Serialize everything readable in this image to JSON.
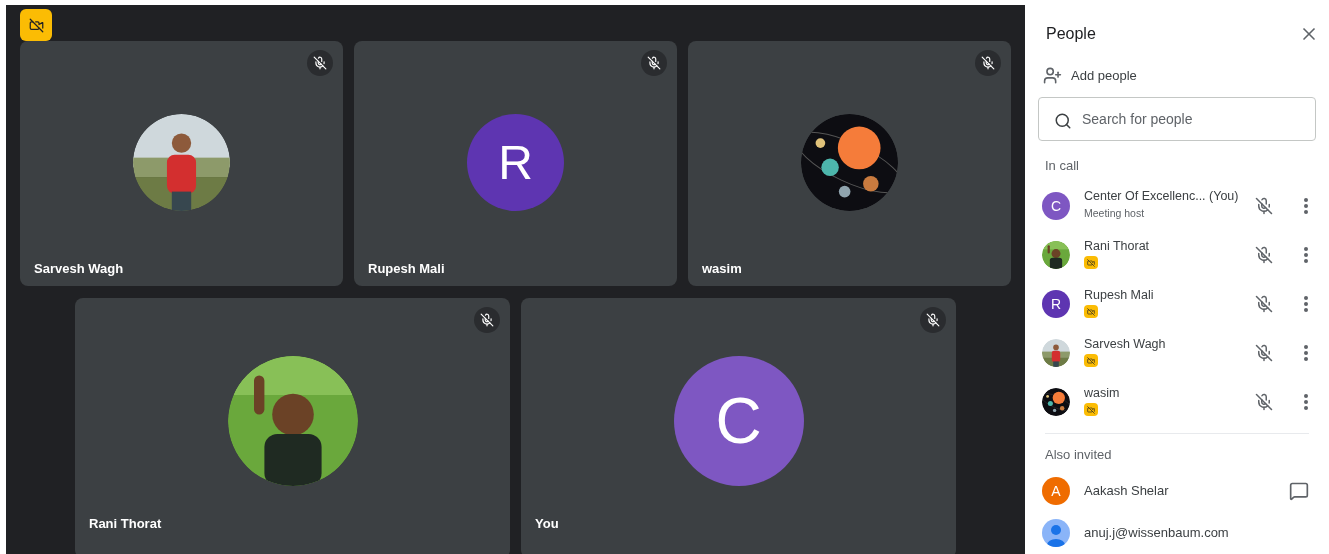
{
  "tiles": [
    {
      "name": "Sarvesh Wagh",
      "muted": true
    },
    {
      "name": "Rupesh Mali",
      "muted": true,
      "avatar": {
        "kind": "letter",
        "letter": "R",
        "color": "#5e35b1"
      }
    },
    {
      "name": "wasim",
      "muted": true
    },
    {
      "name": "Rani Thorat",
      "muted": true
    },
    {
      "name": "You",
      "muted": true,
      "avatar": {
        "kind": "letter",
        "letter": "C",
        "color": "#7e57c2"
      }
    }
  ],
  "panel": {
    "title": "People",
    "add_people": "Add people",
    "search": {
      "placeholder": "Search for people"
    },
    "in_call_heading": "In call",
    "in_call": [
      {
        "name": "Center Of Excellenc... (You)",
        "subtitle": "Meeting host",
        "camera_off": false,
        "muted": true,
        "avatar": {
          "kind": "letter",
          "letter": "C",
          "color": "#7e57c2"
        }
      },
      {
        "name": "Rani Thorat",
        "camera_off": true,
        "muted": true
      },
      {
        "name": "Rupesh Mali",
        "camera_off": true,
        "muted": true,
        "avatar": {
          "kind": "letter",
          "letter": "R",
          "color": "#5e35b1"
        }
      },
      {
        "name": "Sarvesh Wagh",
        "camera_off": true,
        "muted": true
      },
      {
        "name": "wasim",
        "camera_off": true,
        "muted": true
      }
    ],
    "also_invited_heading": "Also invited",
    "invited": [
      {
        "name": "Aakash Shelar",
        "avatar": {
          "kind": "letter",
          "letter": "A",
          "color": "#ef6c00"
        }
      },
      {
        "name": "anuj.j@wissenbaum.com",
        "avatar": {
          "kind": "silhouette",
          "color": "#8ab4f8"
        }
      }
    ]
  }
}
